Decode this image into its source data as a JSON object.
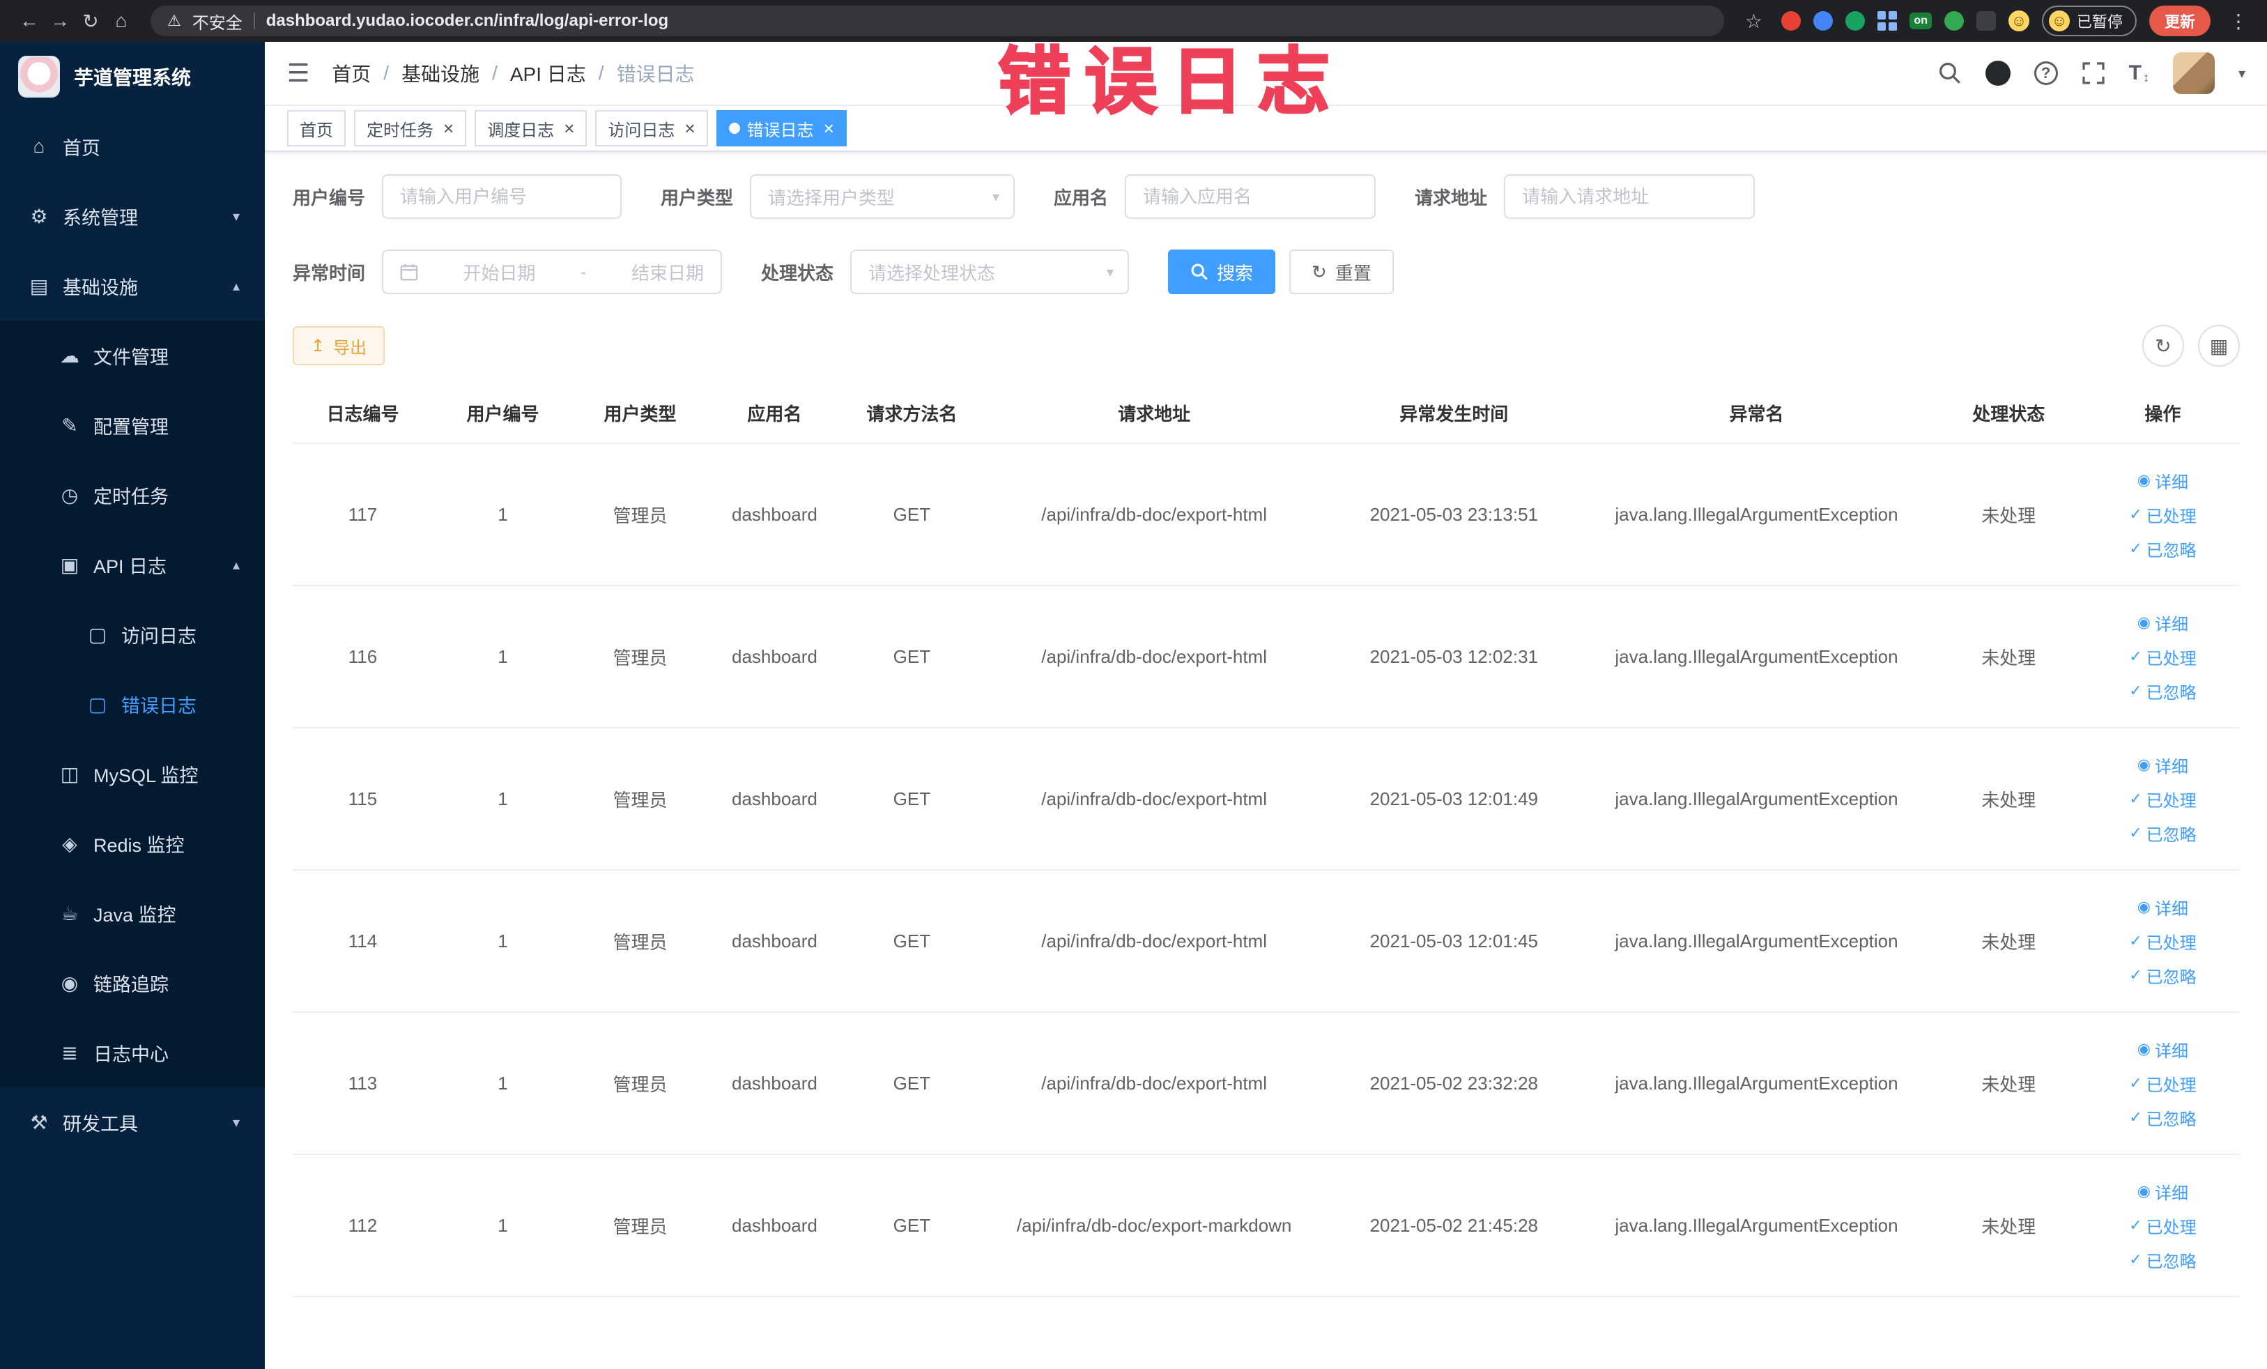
{
  "accent_color": "#409eff",
  "annotation": {
    "text": "错误日志",
    "color": "#ee4058"
  },
  "browser": {
    "security_label": "不安全",
    "url": "dashboard.yudao.iocoder.cn/infra/log/api-error-log",
    "paused_badge": "已暂停",
    "update_button": "更新",
    "extension_badge_on": "on"
  },
  "icons": {
    "back": "←",
    "forward": "→",
    "reload": "↻",
    "home": "⌂",
    "warning": "⚠",
    "star": "☆",
    "dots": "⋮",
    "smile": "☺",
    "hamburger": "☰",
    "question": "?",
    "fontsize": "T",
    "updown": "↕",
    "caret": "▾",
    "chevup": "▴",
    "chevdown": "▾",
    "close": "×",
    "system": "⚙",
    "infra": "▤",
    "file": "☁",
    "config": "✎",
    "job": "◷",
    "apilog": "▣",
    "doc": "▢",
    "mysql": "◫",
    "redis": "◈",
    "java": "☕",
    "trace": "◉",
    "logcenter": "≣",
    "tools": "⚒",
    "view": "◉",
    "check": "✓",
    "export": "↥",
    "refresh": "↻",
    "columns": "▦"
  },
  "sidebar": {
    "logo_title": "芋道管理系统",
    "items": [
      {
        "name": "home",
        "label": "首页",
        "icon": "home",
        "level": 1
      },
      {
        "name": "system-mgmt",
        "label": "系统管理",
        "icon": "system",
        "level": 1,
        "arrow": "down"
      },
      {
        "name": "infrastructure",
        "label": "基础设施",
        "icon": "infra",
        "level": 1,
        "arrow": "up"
      },
      {
        "name": "file-mgmt",
        "label": "文件管理",
        "icon": "file",
        "level": 2
      },
      {
        "name": "config-mgmt",
        "label": "配置管理",
        "icon": "config",
        "level": 2
      },
      {
        "name": "scheduled-jobs",
        "label": "定时任务",
        "icon": "job",
        "level": 2
      },
      {
        "name": "api-log",
        "label": "API 日志",
        "icon": "apilog",
        "level": 2,
        "arrow": "up"
      },
      {
        "name": "access-log",
        "label": "访问日志",
        "icon": "doc",
        "level": 3
      },
      {
        "name": "error-log",
        "label": "错误日志",
        "icon": "doc",
        "level": 3,
        "active": true
      },
      {
        "name": "mysql-monitor",
        "label": "MySQL 监控",
        "icon": "mysql",
        "level": 2
      },
      {
        "name": "redis-monitor",
        "label": "Redis 监控",
        "icon": "redis",
        "level": 2
      },
      {
        "name": "java-monitor",
        "label": "Java 监控",
        "icon": "java",
        "level": 2
      },
      {
        "name": "trace",
        "label": "链路追踪",
        "icon": "trace",
        "level": 2
      },
      {
        "name": "log-center",
        "label": "日志中心",
        "icon": "logcenter",
        "level": 2
      },
      {
        "name": "dev-tools",
        "label": "研发工具",
        "icon": "tools",
        "level": 1,
        "arrow": "down"
      }
    ]
  },
  "header": {
    "breadcrumb": [
      "首页",
      "基础设施",
      "API 日志",
      "错误日志"
    ],
    "breadcrumb_separator": "/"
  },
  "tabs": [
    {
      "name": "home",
      "label": "首页",
      "closable": false
    },
    {
      "name": "job",
      "label": "定时任务",
      "closable": true
    },
    {
      "name": "job-log",
      "label": "调度日志",
      "closable": true
    },
    {
      "name": "access-log",
      "label": "访问日志",
      "closable": true
    },
    {
      "name": "error-log",
      "label": "错误日志",
      "closable": true,
      "active": true
    }
  ],
  "filters": {
    "user_id": {
      "label": "用户编号",
      "placeholder": "请输入用户编号"
    },
    "user_type": {
      "label": "用户类型",
      "placeholder": "请选择用户类型"
    },
    "app_name": {
      "label": "应用名",
      "placeholder": "请输入应用名"
    },
    "request_url": {
      "label": "请求地址",
      "placeholder": "请输入请求地址"
    },
    "exception_time": {
      "label": "异常时间",
      "start_placeholder": "开始日期",
      "separator": "-",
      "end_placeholder": "结束日期"
    },
    "process_status": {
      "label": "处理状态",
      "placeholder": "请选择处理状态"
    },
    "search_button": "搜索",
    "reset_button": "重置"
  },
  "toolbar": {
    "export_button": "导出"
  },
  "table": {
    "columns": [
      "日志编号",
      "用户编号",
      "用户类型",
      "应用名",
      "请求方法名",
      "请求地址",
      "异常发生时间",
      "异常名",
      "处理状态",
      "操作"
    ],
    "rows": [
      {
        "id": "117",
        "user_id": "1",
        "user_type": "管理员",
        "app": "dashboard",
        "method": "GET",
        "url": "/api/infra/db-doc/export-html",
        "time": "2021-05-03 23:13:51",
        "exception": "java.lang.IllegalArgumentException",
        "status": "未处理"
      },
      {
        "id": "116",
        "user_id": "1",
        "user_type": "管理员",
        "app": "dashboard",
        "method": "GET",
        "url": "/api/infra/db-doc/export-html",
        "time": "2021-05-03 12:02:31",
        "exception": "java.lang.IllegalArgumentException",
        "status": "未处理"
      },
      {
        "id": "115",
        "user_id": "1",
        "user_type": "管理员",
        "app": "dashboard",
        "method": "GET",
        "url": "/api/infra/db-doc/export-html",
        "time": "2021-05-03 12:01:49",
        "exception": "java.lang.IllegalArgumentException",
        "status": "未处理"
      },
      {
        "id": "114",
        "user_id": "1",
        "user_type": "管理员",
        "app": "dashboard",
        "method": "GET",
        "url": "/api/infra/db-doc/export-html",
        "time": "2021-05-03 12:01:45",
        "exception": "java.lang.IllegalArgumentException",
        "status": "未处理"
      },
      {
        "id": "113",
        "user_id": "1",
        "user_type": "管理员",
        "app": "dashboard",
        "method": "GET",
        "url": "/api/infra/db-doc/export-html",
        "time": "2021-05-02 23:32:28",
        "exception": "java.lang.IllegalArgumentException",
        "status": "未处理"
      },
      {
        "id": "112",
        "user_id": "1",
        "user_type": "管理员",
        "app": "dashboard",
        "method": "GET",
        "url": "/api/infra/db-doc/export-markdown",
        "time": "2021-05-02 21:45:28",
        "exception": "java.lang.IllegalArgumentException",
        "status": "未处理"
      }
    ],
    "row_actions": [
      {
        "name": "detail",
        "label": "详细",
        "icon": "view"
      },
      {
        "name": "processed",
        "label": "已处理",
        "icon": "check"
      },
      {
        "name": "ignored",
        "label": "已忽略",
        "icon": "check"
      }
    ]
  }
}
